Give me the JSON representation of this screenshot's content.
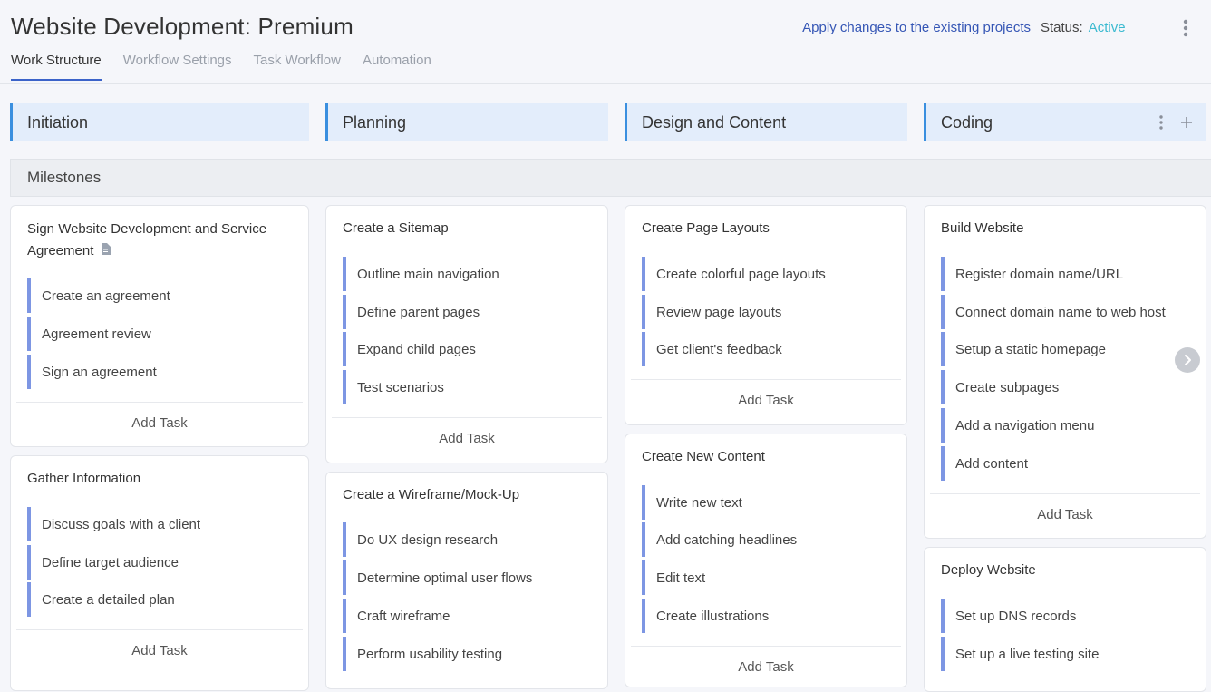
{
  "header": {
    "title": "Website Development: Premium",
    "apply_link": "Apply changes to the existing projects",
    "status_label": "Status:",
    "status_value": "Active"
  },
  "tabs": [
    {
      "label": "Work Structure",
      "active": true
    },
    {
      "label": "Workflow Settings",
      "active": false
    },
    {
      "label": "Task Workflow",
      "active": false
    },
    {
      "label": "Automation",
      "active": false
    }
  ],
  "stages": [
    "Initiation",
    "Planning",
    "Design and Content",
    "Coding"
  ],
  "milestones_label": "Milestones",
  "add_task_label": "Add Task",
  "columns": [
    {
      "cards": [
        {
          "title": "Sign Website Development and Service Agreement",
          "has_doc_icon": true,
          "tasks": [
            "Create an agreement",
            "Agreement review",
            "Sign an agreement"
          ]
        },
        {
          "title": "Gather Information",
          "tasks": [
            "Discuss goals with a client",
            "Define target audience",
            "Create a detailed plan"
          ]
        }
      ]
    },
    {
      "cards": [
        {
          "title": "Create a Sitemap",
          "tasks": [
            "Outline main navigation",
            "Define parent pages",
            "Expand child pages",
            "Test scenarios"
          ]
        },
        {
          "title": "Create a Wireframe/Mock-Up",
          "tasks": [
            "Do UX design research",
            "Determine optimal user flows",
            "Craft wireframe",
            "Perform usability testing"
          ]
        }
      ]
    },
    {
      "cards": [
        {
          "title": "Create Page Layouts",
          "tasks": [
            "Create colorful page layouts",
            "Review page layouts",
            "Get client's feedback"
          ]
        },
        {
          "title": "Create New Content",
          "tasks": [
            "Write new text",
            "Add catching headlines",
            "Edit text",
            "Create illustrations"
          ]
        }
      ]
    },
    {
      "cards": [
        {
          "title": "Build Website",
          "tasks": [
            "Register domain name/URL",
            "Connect domain name to web host",
            "Setup a static homepage",
            "Create subpages",
            "Add a navigation menu",
            "Add content"
          ]
        },
        {
          "title": "Deploy Website",
          "tasks": [
            "Set up DNS records",
            "Set up a live testing site"
          ]
        }
      ]
    }
  ]
}
